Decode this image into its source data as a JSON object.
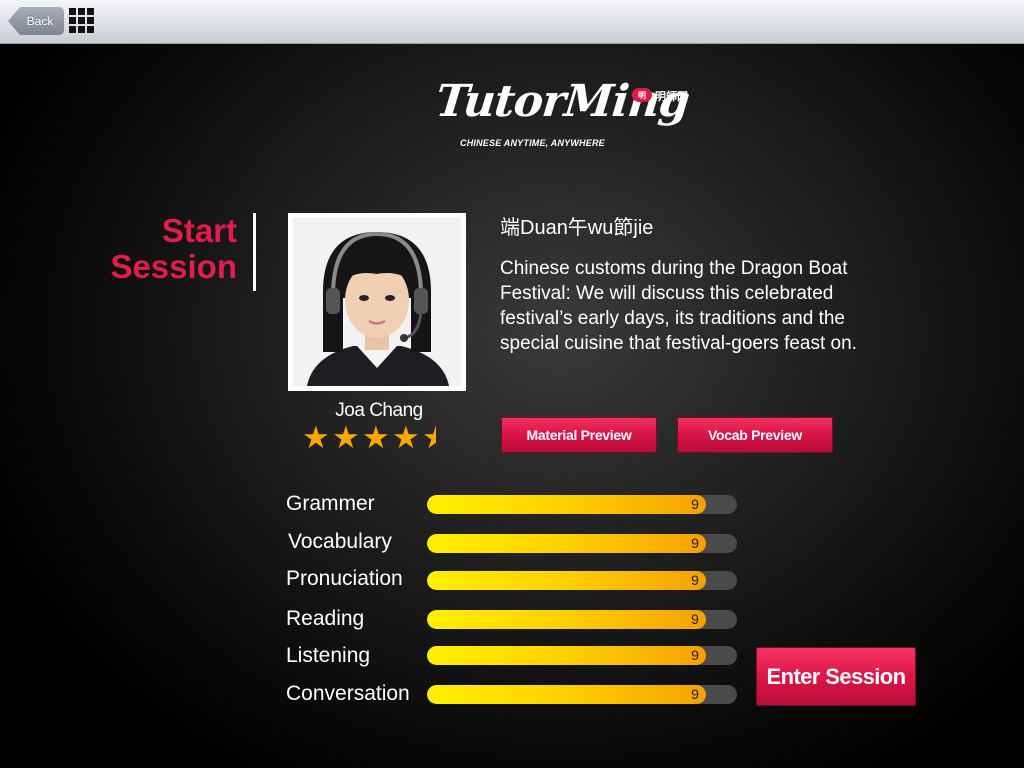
{
  "topbar": {
    "back_label": "Back",
    "menu_icon": "grid-icon"
  },
  "logo": {
    "wordmark": "TutorMing",
    "tagline": "CHINESE ANYTIME, ANYWHERE",
    "badge": "明",
    "partner_cn": "明師网"
  },
  "page": {
    "title_line1": "Start",
    "title_line2": "Session",
    "accent_color": "#e21c4f"
  },
  "tutor": {
    "name": "Joa Chang",
    "rating": 4.5,
    "rating_max": 5,
    "photo_icon": "tutor-photo"
  },
  "session": {
    "title": "端Duan午wu節jie",
    "description": "Chinese customs during the Dragon Boat Festival: We will discuss this celebrated festival’s early days, its traditions and the special cuisine that festival-goers feast on.",
    "material_button": "Material Preview",
    "vocab_button": "Vocab Preview",
    "enter_button": "Enter Session"
  },
  "skills": [
    {
      "label": "Grammer",
      "value": "9",
      "level": 0.9
    },
    {
      "label": "Vocabulary",
      "value": "9",
      "level": 0.9
    },
    {
      "label": "Pronuciation",
      "value": "9",
      "level": 0.9
    },
    {
      "label": "Reading",
      "value": "9",
      "level": 0.9
    },
    {
      "label": "Listening",
      "value": "9",
      "level": 0.9
    },
    {
      "label": "Conversation",
      "value": "9",
      "level": 0.9
    }
  ]
}
